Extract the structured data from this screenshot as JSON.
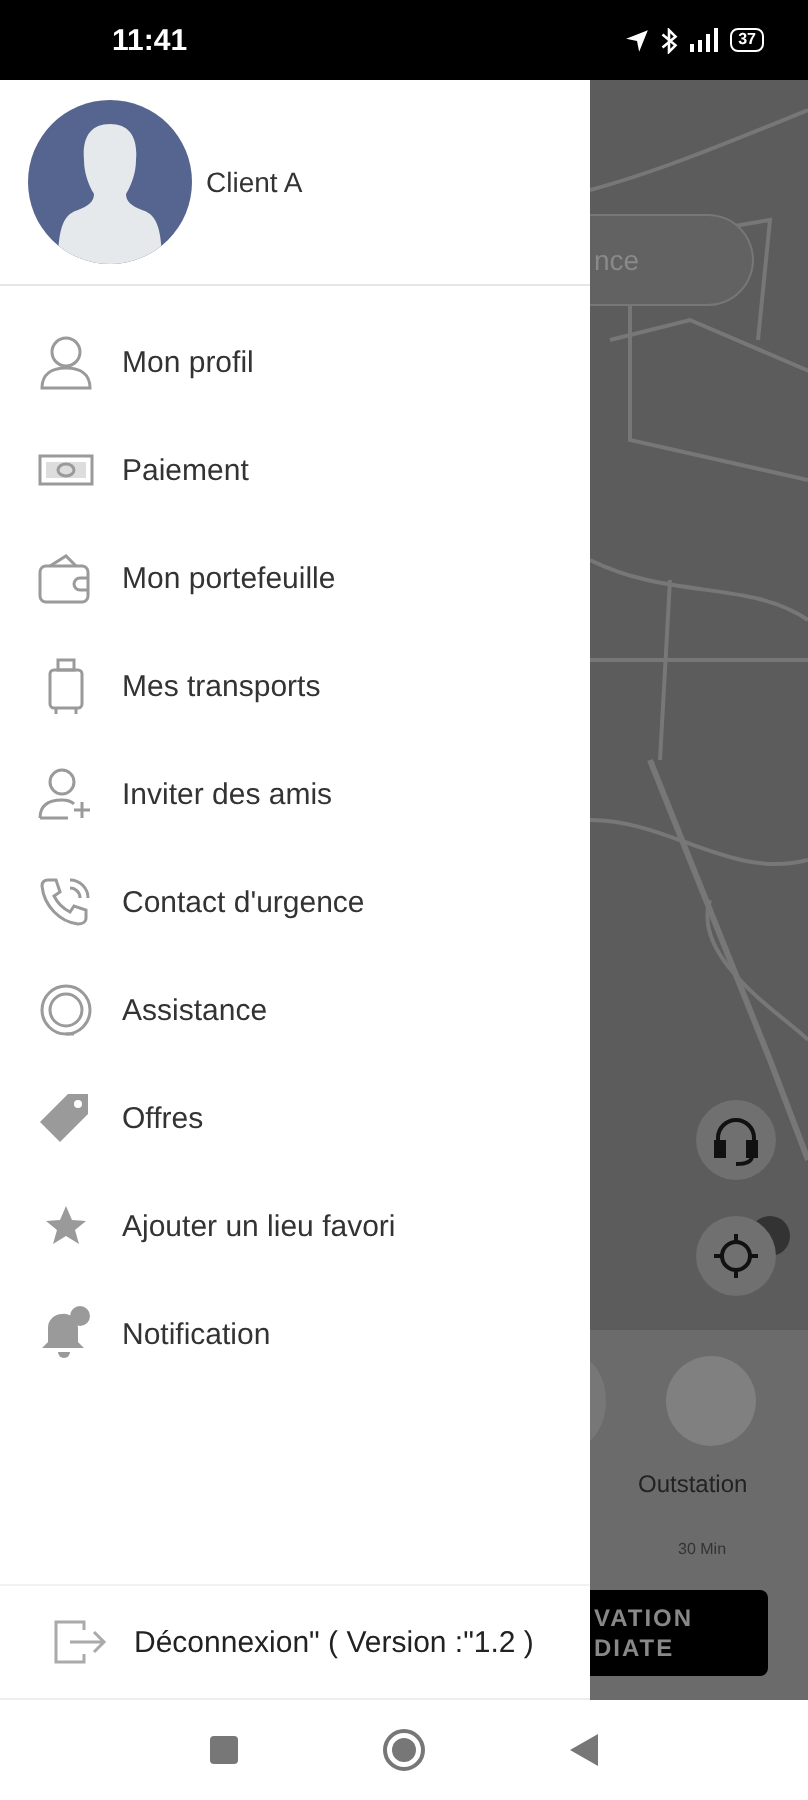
{
  "status_bar": {
    "time": "11:41",
    "battery": "37"
  },
  "drawer": {
    "user": {
      "name": "Client A"
    },
    "items": [
      {
        "label": "Mon profil"
      },
      {
        "label": "Paiement"
      },
      {
        "label": "Mon portefeuille"
      },
      {
        "label": "Mes transports"
      },
      {
        "label": "Inviter des amis"
      },
      {
        "label": "Contact d'urgence"
      },
      {
        "label": "Assistance"
      },
      {
        "label": "Offres"
      },
      {
        "label": "Ajouter un lieu favori"
      },
      {
        "label": "Notification"
      }
    ],
    "logout": {
      "label": "Déconnexion\" ( Version :\"1.2 )"
    }
  },
  "map": {
    "search": {
      "placeholder": "nce"
    },
    "ride_option": {
      "label": "Outstation",
      "eta": "30 Min"
    },
    "book_button": {
      "label": "VATION\nDIATE"
    }
  }
}
